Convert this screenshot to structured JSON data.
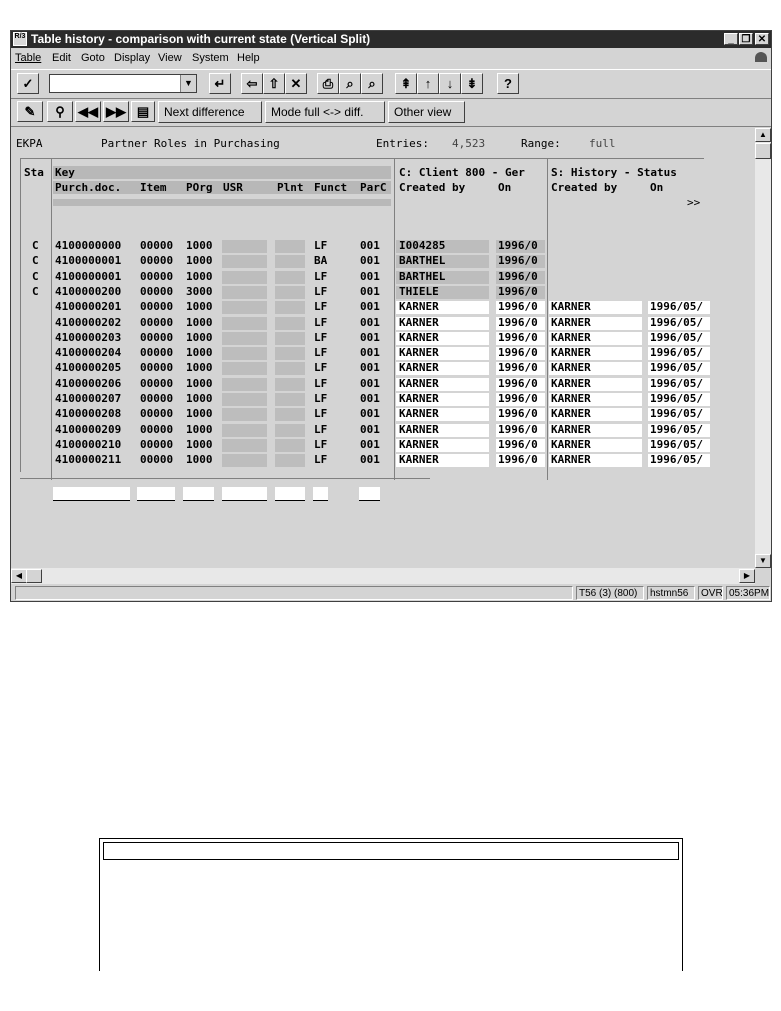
{
  "window": {
    "title": "Table history - comparison with current state (Vertical Split)",
    "app_icon_text": "R/3"
  },
  "menu": [
    "Table",
    "Edit",
    "Goto",
    "Display",
    "View",
    "System",
    "Help"
  ],
  "toolbar2": {
    "next_difference": "Next difference",
    "mode_toggle": "Mode full <-> diff.",
    "other_view": "Other view"
  },
  "header": {
    "table_name": "EKPA",
    "description": "Partner Roles in Purchasing",
    "entries_label": "Entries:",
    "entries_value": "4,523",
    "range_label": "Range:",
    "range_value": "full"
  },
  "grid": {
    "sta_label": "Sta",
    "key_label": "Key",
    "columns": [
      "Purch.doc.",
      "Item",
      "POrg",
      "USR",
      "Plnt",
      "Funct",
      "ParC"
    ],
    "c_group": "C: Client 800 - Ger",
    "c_columns": [
      "Created by",
      "On"
    ],
    "s_group": "S: History - Status",
    "s_columns": [
      "Created by",
      "On"
    ],
    "more": ">>",
    "rows": [
      {
        "sta": "C",
        "doc": "4100000000",
        "item": "00000",
        "porg": "1000",
        "funct": "LF",
        "parc": "001",
        "c_by": "I004285",
        "c_on": "1996/0",
        "s_by": "",
        "s_on": ""
      },
      {
        "sta": "C",
        "doc": "4100000001",
        "item": "00000",
        "porg": "1000",
        "funct": "BA",
        "parc": "001",
        "c_by": "BARTHEL",
        "c_on": "1996/0",
        "s_by": "",
        "s_on": ""
      },
      {
        "sta": "C",
        "doc": "4100000001",
        "item": "00000",
        "porg": "1000",
        "funct": "LF",
        "parc": "001",
        "c_by": "BARTHEL",
        "c_on": "1996/0",
        "s_by": "",
        "s_on": ""
      },
      {
        "sta": "C",
        "doc": "4100000200",
        "item": "00000",
        "porg": "3000",
        "funct": "LF",
        "parc": "001",
        "c_by": "THIELE",
        "c_on": "1996/0",
        "s_by": "",
        "s_on": ""
      },
      {
        "sta": "",
        "doc": "4100000201",
        "item": "00000",
        "porg": "1000",
        "funct": "LF",
        "parc": "001",
        "c_by": "KARNER",
        "c_on": "1996/0",
        "s_by": "KARNER",
        "s_on": "1996/05/"
      },
      {
        "sta": "",
        "doc": "4100000202",
        "item": "00000",
        "porg": "1000",
        "funct": "LF",
        "parc": "001",
        "c_by": "KARNER",
        "c_on": "1996/0",
        "s_by": "KARNER",
        "s_on": "1996/05/"
      },
      {
        "sta": "",
        "doc": "4100000203",
        "item": "00000",
        "porg": "1000",
        "funct": "LF",
        "parc": "001",
        "c_by": "KARNER",
        "c_on": "1996/0",
        "s_by": "KARNER",
        "s_on": "1996/05/"
      },
      {
        "sta": "",
        "doc": "4100000204",
        "item": "00000",
        "porg": "1000",
        "funct": "LF",
        "parc": "001",
        "c_by": "KARNER",
        "c_on": "1996/0",
        "s_by": "KARNER",
        "s_on": "1996/05/"
      },
      {
        "sta": "",
        "doc": "4100000205",
        "item": "00000",
        "porg": "1000",
        "funct": "LF",
        "parc": "001",
        "c_by": "KARNER",
        "c_on": "1996/0",
        "s_by": "KARNER",
        "s_on": "1996/05/"
      },
      {
        "sta": "",
        "doc": "4100000206",
        "item": "00000",
        "porg": "1000",
        "funct": "LF",
        "parc": "001",
        "c_by": "KARNER",
        "c_on": "1996/0",
        "s_by": "KARNER",
        "s_on": "1996/05/"
      },
      {
        "sta": "",
        "doc": "4100000207",
        "item": "00000",
        "porg": "1000",
        "funct": "LF",
        "parc": "001",
        "c_by": "KARNER",
        "c_on": "1996/0",
        "s_by": "KARNER",
        "s_on": "1996/05/"
      },
      {
        "sta": "",
        "doc": "4100000208",
        "item": "00000",
        "porg": "1000",
        "funct": "LF",
        "parc": "001",
        "c_by": "KARNER",
        "c_on": "1996/0",
        "s_by": "KARNER",
        "s_on": "1996/05/"
      },
      {
        "sta": "",
        "doc": "4100000209",
        "item": "00000",
        "porg": "1000",
        "funct": "LF",
        "parc": "001",
        "c_by": "KARNER",
        "c_on": "1996/0",
        "s_by": "KARNER",
        "s_on": "1996/05/"
      },
      {
        "sta": "",
        "doc": "4100000210",
        "item": "00000",
        "porg": "1000",
        "funct": "LF",
        "parc": "001",
        "c_by": "KARNER",
        "c_on": "1996/0",
        "s_by": "KARNER",
        "s_on": "1996/05/"
      },
      {
        "sta": "",
        "doc": "4100000211",
        "item": "00000",
        "porg": "1000",
        "funct": "LF",
        "parc": "001",
        "c_by": "KARNER",
        "c_on": "1996/0",
        "s_by": "KARNER",
        "s_on": "1996/05/"
      }
    ]
  },
  "status": {
    "system": "T56 (3) (800)",
    "server": "hstmn56",
    "mode": "OVR",
    "time": "05:36PM"
  }
}
